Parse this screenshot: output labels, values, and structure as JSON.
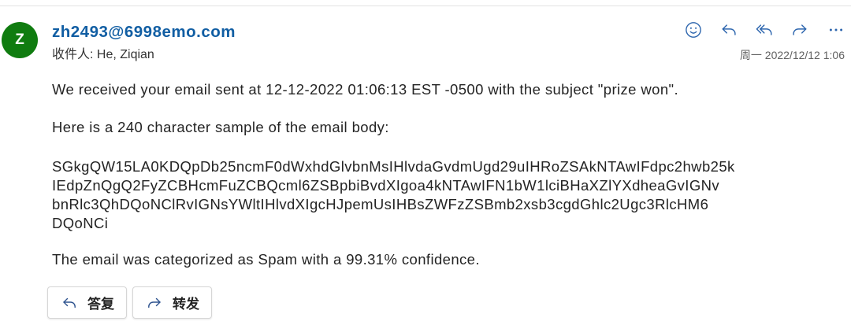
{
  "sender": {
    "avatar_initial": "Z",
    "email": "zh2493@6998emo.com",
    "recipients_label": "收件人:",
    "recipients": "He, Ziqian",
    "date": "周一 2022/12/12 1:06"
  },
  "header_actions": {
    "icons": [
      "smiley-icon",
      "reply-icon",
      "reply-all-icon",
      "forward-icon",
      "more-icon"
    ]
  },
  "body": {
    "intro": "We received your email sent at 12-12-2022 01:06:13 EST -0500 with the subject \"prize won\".",
    "sample_heading": "Here is a 240 character sample of the email body:",
    "sample_lines": [
      "SGkgQW15LA0KDQpDb25ncmF0dWxhdGlvbnMsIHlvdaGvdmUgd29uIHRoZSAkNTAwIFdpc2hwb25k",
      "IEdpZnQgQ2FyZCBHcmFuZCBQcml6ZSBpbiBvdXIgoa4kNTAwIFN1bW1lciBHaXZlYXdheaGvIGNv",
      "bnRlc3QhDQoNClRvIGNsYWltIHlvdXIgcHJpemUsIHBsZWFzZSBmb2xsb3cgdGhlc2Ugc3RlcHM6",
      "DQoNCi"
    ],
    "verdict": "The email was categorized as Spam with a 99.31% confidence."
  },
  "footer_actions": {
    "reply_label": "答复",
    "reply_icon": "reply-icon",
    "forward_label": "转发",
    "forward_icon": "forward-icon"
  },
  "colors": {
    "avatar": "#107c10",
    "sender_link": "#115ea3",
    "icon": "#2b64ad",
    "footer_icon": "#2f548f",
    "text": "#242424",
    "muted_text": "#616161"
  }
}
